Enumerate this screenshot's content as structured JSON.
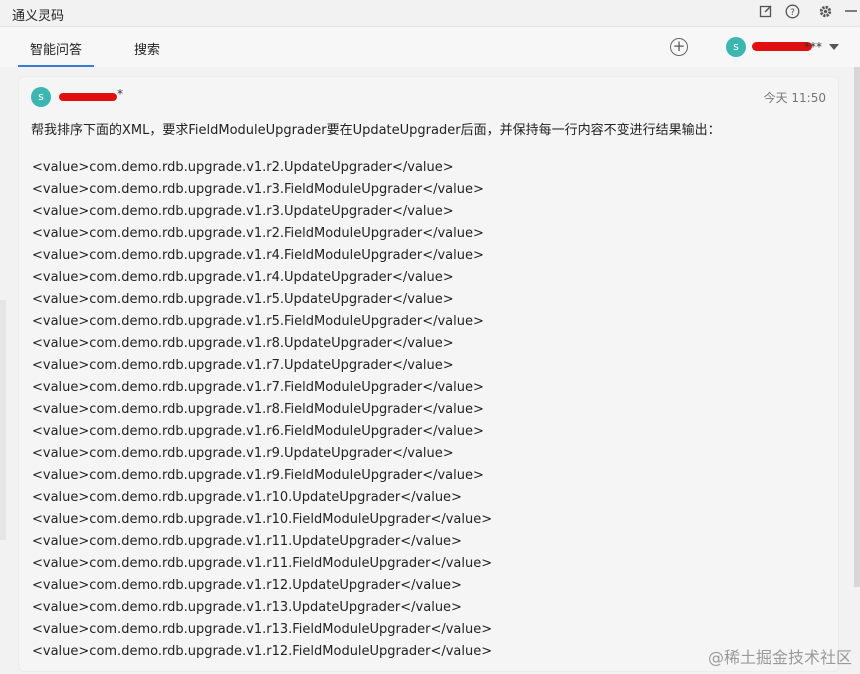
{
  "window": {
    "title": "通义灵码"
  },
  "tabs": [
    {
      "label": "智能问答",
      "active": true
    },
    {
      "label": "搜索",
      "active": false
    }
  ],
  "user": {
    "avatar_letter": "s",
    "name_suffix": "***"
  },
  "message": {
    "author_avatar_letter": "s",
    "author_suffix": "*",
    "time": "今天 11:50",
    "prompt": "帮我排序下面的XML，要求FieldModuleUpgrader要在UpdateUpgrader后面，并保持每一行内容不变进行结果输出：",
    "lines": [
      "<value>com.demo.rdb.upgrade.v1.r2.UpdateUpgrader</value>",
      "<value>com.demo.rdb.upgrade.v1.r3.FieldModuleUpgrader</value>",
      "<value>com.demo.rdb.upgrade.v1.r3.UpdateUpgrader</value>",
      "<value>com.demo.rdb.upgrade.v1.r2.FieldModuleUpgrader</value>",
      "<value>com.demo.rdb.upgrade.v1.r4.FieldModuleUpgrader</value>",
      "<value>com.demo.rdb.upgrade.v1.r4.UpdateUpgrader</value>",
      "<value>com.demo.rdb.upgrade.v1.r5.UpdateUpgrader</value>",
      "<value>com.demo.rdb.upgrade.v1.r5.FieldModuleUpgrader</value>",
      "<value>com.demo.rdb.upgrade.v1.r8.UpdateUpgrader</value>",
      "<value>com.demo.rdb.upgrade.v1.r7.UpdateUpgrader</value>",
      "<value>com.demo.rdb.upgrade.v1.r7.FieldModuleUpgrader</value>",
      "<value>com.demo.rdb.upgrade.v1.r8.FieldModuleUpgrader</value>",
      "<value>com.demo.rdb.upgrade.v1.r6.FieldModuleUpgrader</value>",
      "<value>com.demo.rdb.upgrade.v1.r9.UpdateUpgrader</value>",
      "<value>com.demo.rdb.upgrade.v1.r9.FieldModuleUpgrader</value>",
      "<value>com.demo.rdb.upgrade.v1.r10.UpdateUpgrader</value>",
      "<value>com.demo.rdb.upgrade.v1.r10.FieldModuleUpgrader</value>",
      "<value>com.demo.rdb.upgrade.v1.r11.UpdateUpgrader</value>",
      "<value>com.demo.rdb.upgrade.v1.r11.FieldModuleUpgrader</value>",
      "<value>com.demo.rdb.upgrade.v1.r12.UpdateUpgrader</value>",
      "<value>com.demo.rdb.upgrade.v1.r13.UpdateUpgrader</value>",
      "<value>com.demo.rdb.upgrade.v1.r13.FieldModuleUpgrader</value>",
      "<value>com.demo.rdb.upgrade.v1.r12.FieldModuleUpgrader</value>"
    ]
  },
  "watermark": "@稀土掘金技术社区",
  "colors": {
    "accent": "#3c78d8",
    "avatar": "#3bb6b1",
    "redaction": "#e01010"
  },
  "icons": [
    "edit-icon",
    "help-icon",
    "gear-icon",
    "minimize-icon",
    "add-icon",
    "chevron-down-icon"
  ]
}
